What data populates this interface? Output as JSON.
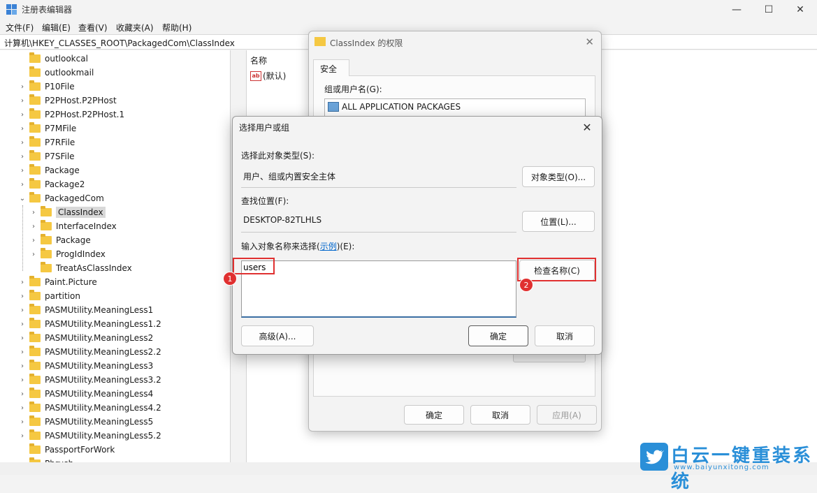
{
  "app": {
    "title": "注册表编辑器"
  },
  "window_controls": {
    "minimize": "—",
    "maximize": "☐",
    "close": "✕"
  },
  "menu": [
    "文件(F)",
    "编辑(E)",
    "查看(V)",
    "收藏夹(A)",
    "帮助(H)"
  ],
  "address": "计算机\\HKEY_CLASSES_ROOT\\PackagedCom\\ClassIndex",
  "tree": [
    {
      "label": "outlookcal",
      "expandable": false,
      "indent": 0
    },
    {
      "label": "outlookmail",
      "expandable": false,
      "indent": 0
    },
    {
      "label": "P10File",
      "expandable": true,
      "indent": 0
    },
    {
      "label": "P2PHost.P2PHost",
      "expandable": true,
      "indent": 0
    },
    {
      "label": "P2PHost.P2PHost.1",
      "expandable": true,
      "indent": 0
    },
    {
      "label": "P7MFile",
      "expandable": true,
      "indent": 0
    },
    {
      "label": "P7RFile",
      "expandable": true,
      "indent": 0
    },
    {
      "label": "P7SFile",
      "expandable": true,
      "indent": 0
    },
    {
      "label": "Package",
      "expandable": true,
      "indent": 0
    },
    {
      "label": "Package2",
      "expandable": true,
      "indent": 0
    },
    {
      "label": "PackagedCom",
      "expandable": true,
      "expanded": true,
      "indent": 0
    },
    {
      "label": "ClassIndex",
      "expandable": true,
      "indent": 1,
      "selected": true
    },
    {
      "label": "InterfaceIndex",
      "expandable": true,
      "indent": 1
    },
    {
      "label": "Package",
      "expandable": true,
      "indent": 1
    },
    {
      "label": "ProgIdIndex",
      "expandable": true,
      "indent": 1
    },
    {
      "label": "TreatAsClassIndex",
      "expandable": false,
      "indent": 1
    },
    {
      "label": "Paint.Picture",
      "expandable": true,
      "indent": 0
    },
    {
      "label": "partition",
      "expandable": true,
      "indent": 0
    },
    {
      "label": "PASMUtility.MeaningLess1",
      "expandable": true,
      "indent": 0
    },
    {
      "label": "PASMUtility.MeaningLess1.2",
      "expandable": true,
      "indent": 0
    },
    {
      "label": "PASMUtility.MeaningLess2",
      "expandable": true,
      "indent": 0
    },
    {
      "label": "PASMUtility.MeaningLess2.2",
      "expandable": true,
      "indent": 0
    },
    {
      "label": "PASMUtility.MeaningLess3",
      "expandable": true,
      "indent": 0
    },
    {
      "label": "PASMUtility.MeaningLess3.2",
      "expandable": true,
      "indent": 0
    },
    {
      "label": "PASMUtility.MeaningLess4",
      "expandable": true,
      "indent": 0
    },
    {
      "label": "PASMUtility.MeaningLess4.2",
      "expandable": true,
      "indent": 0
    },
    {
      "label": "PASMUtility.MeaningLess5",
      "expandable": true,
      "indent": 0
    },
    {
      "label": "PASMUtility.MeaningLess5.2",
      "expandable": true,
      "indent": 0
    },
    {
      "label": "PassportForWork",
      "expandable": false,
      "indent": 0
    },
    {
      "label": "Pbrush",
      "expandable": true,
      "indent": 0
    }
  ],
  "values_pane": {
    "column_name": "名称",
    "default_value": "(默认)",
    "value_icon": "ab"
  },
  "perm_dialog": {
    "title": "ClassIndex 的权限",
    "tab": "安全",
    "group_label": "组或用户名(G):",
    "list_item": "ALL APPLICATION PACKAGES",
    "ok": "确定",
    "cancel": "取消",
    "apply": "应用(A)"
  },
  "select_dialog": {
    "title": "选择用户或组",
    "object_type_label": "选择此对象类型(S):",
    "object_type_value": "用户、组或内置安全主体",
    "object_type_button": "对象类型(O)...",
    "location_label": "查找位置(F):",
    "location_value": "DESKTOP-82TLHLS",
    "location_button": "位置(L)...",
    "names_label_prefix": "输入对象名称来选择(",
    "names_label_link": "示例",
    "names_label_suffix": ")(E):",
    "names_value": "users",
    "check_names_button": "检查名称(C)",
    "advanced_button": "高级(A)...",
    "ok": "确定",
    "cancel": "取消"
  },
  "annotations": {
    "badge1": "1",
    "badge2": "2",
    "highlight_color": "#e03030"
  },
  "watermark": {
    "text": "白云一键重装系统",
    "url": "www.baiyunxitong.com",
    "icon": "bird-icon"
  }
}
